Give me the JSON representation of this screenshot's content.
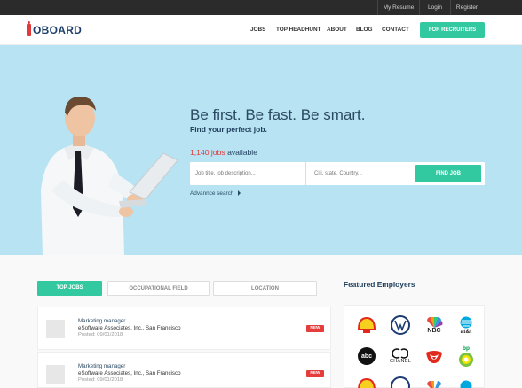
{
  "topbar": {
    "my_resume": "My Resume",
    "login": "Login",
    "register": "Register"
  },
  "brand": {
    "name": "OBOARD"
  },
  "nav": [
    "JOBS",
    "TOP HEADHUNT",
    "ABOUT",
    "BLOG",
    "CONTACT"
  ],
  "header": {
    "recruiters_button": "FOR RECRUITERS"
  },
  "hero": {
    "title": "Be first. Be fast. Be smart.",
    "subtitle": "Find your perfect job.",
    "jobs_count": "1,140 jobs",
    "jobs_suffix": "available",
    "keyword_placeholder": "Job title, job description...",
    "location_placeholder": "Citi, state, Country...",
    "find_button": "FIND JOB",
    "advanced_link": "Advannce search"
  },
  "tabs": [
    "TOP JOBS",
    "OCCUPATIONAL FIELD",
    "LOCATION"
  ],
  "jobs": [
    {
      "title": "Marketing manager",
      "company": "eSoftware Associates, Inc., San Francisco",
      "posted": "Posted: 09/01/2018",
      "badge": "NEW"
    },
    {
      "title": "Marketing manager",
      "company": "eSoftware Associates, Inc., San Francisco",
      "posted": "Posted: 09/01/2018",
      "badge": "NEW"
    }
  ],
  "featured": {
    "title": "Featured Employers",
    "logos": [
      {
        "name": "shell-logo",
        "text": ""
      },
      {
        "name": "volkswagen-logo",
        "text": ""
      },
      {
        "name": "nbc-logo",
        "text": "NBC"
      },
      {
        "name": "att-logo",
        "text": "at&t"
      },
      {
        "name": "abc-logo",
        "text": "abc"
      },
      {
        "name": "chanel-logo",
        "text": "CHANEL"
      },
      {
        "name": "rolling-stones-logo",
        "text": ""
      },
      {
        "name": "bp-logo",
        "text": "bp"
      }
    ]
  },
  "colors": {
    "accent": "#33c9a0",
    "hero_bg": "#b8e3f2",
    "navy": "#1f3f5c",
    "red": "#e03a3a",
    "topbar": "#2b2b2b"
  }
}
